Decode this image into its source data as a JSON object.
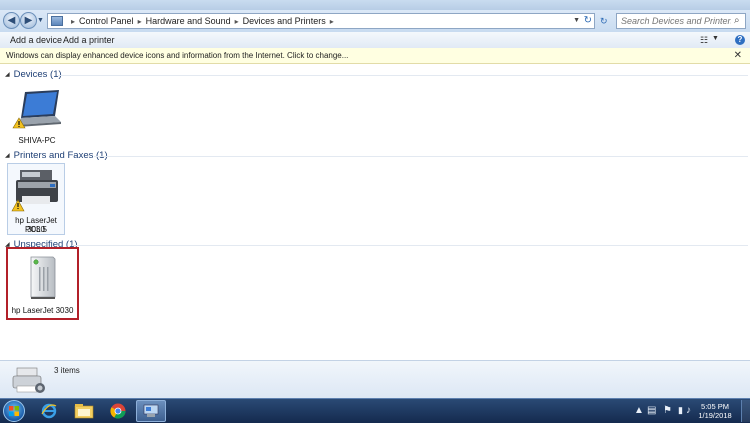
{
  "window": {
    "search_placeholder": "Search Devices and Printers",
    "breadcrumb": [
      "Control Panel",
      "Hardware and Sound",
      "Devices and Printers"
    ]
  },
  "toolbar": {
    "add_device": "Add a device",
    "add_printer": "Add a printer"
  },
  "infobar": {
    "message": "Windows can display enhanced device icons and information from the Internet. Click to change...",
    "close": "✕"
  },
  "groups": [
    {
      "title": "Devices (1)",
      "items": [
        {
          "label": "SHIVA-PC",
          "icon": "laptop-warning-icon"
        }
      ]
    },
    {
      "title": "Printers and Faxes (1)",
      "items": [
        {
          "label_line1": "hp LaserJet 3030",
          "label_line2": "PCL 5",
          "icon": "multifunction-printer-warning-icon"
        }
      ]
    },
    {
      "title": "Unspecified (1)",
      "items": [
        {
          "label": "hp LaserJet 3030",
          "icon": "generic-device-icon"
        }
      ]
    }
  ],
  "details": {
    "count": "3 items"
  },
  "taskbar": {
    "time": "5:05 PM",
    "date": "1/19/2018",
    "pinned": [
      "internet-explorer-icon",
      "file-explorer-icon",
      "chrome-icon",
      "devices-and-printers-icon"
    ]
  },
  "colors": {
    "highlight_border": "#b22029",
    "group_header": "#1e3f75",
    "taskbar": "#1c355e"
  }
}
